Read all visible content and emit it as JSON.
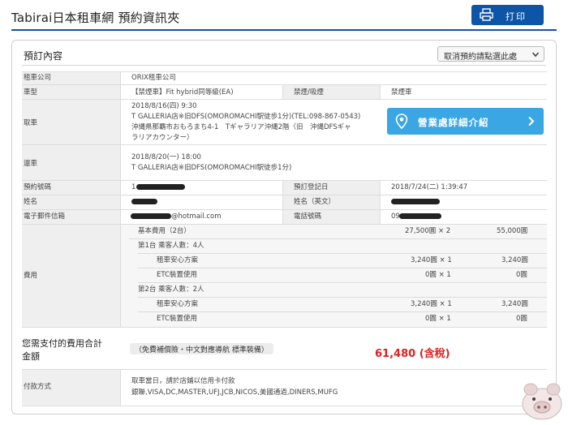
{
  "header": {
    "title": "Tabirai日本租車網 預約資訊夾",
    "print_label": "打印"
  },
  "card": {
    "title": "預訂內容",
    "cancel_select": "取消預約請點選此處"
  },
  "rows": {
    "company": {
      "label": "租車公司",
      "value": "ORIX租車公司"
    },
    "car_type": {
      "label": "車型",
      "value": "【禁煙車】Fit  hybrid同等級(EA)",
      "smoke_label": "禁煙/吸煙",
      "smoke_value": "禁煙車"
    },
    "pickup": {
      "label": "取車",
      "line1": "2018/8/16(四) 9:30",
      "line2": "T GALLERIA店※旧DFS(OMOROMACHI駅徒歩1分)(TEL:098-867-0543)",
      "line3": "沖縄県那覇市おもろまち4-1　Tギャラリア沖縄2階（旧　沖縄DFSギャ",
      "line4": "ラリアカウンター）",
      "guide_button": "營業處詳細介紹"
    },
    "return": {
      "label": "還車",
      "line1": "2018/8/20(一) 18:00",
      "line2": "T GALLERIA店※旧DFS(OMOROMACHI駅徒歩1分)"
    },
    "booking_no": {
      "label": "預約號碼",
      "value": "1",
      "reg_label": "預訂登記日",
      "reg_value": "2018/7/24(二) 1:39:47"
    },
    "name": {
      "label": "姓名",
      "en_label": "姓名（英文）"
    },
    "email": {
      "label": "電子郵件信箱",
      "value": "@hotmail.com",
      "phone_label": "電話號碼",
      "phone_value": "09"
    },
    "fees": {
      "label": "費用",
      "basic": {
        "label": "基本費用（2台）",
        "unit": "27,500圓 × 2",
        "total": "55,000圓"
      },
      "car1": {
        "label": "第1台 乘客人數：4人"
      },
      "car1_items": [
        {
          "label": "租車安心方案",
          "unit": "3,240圓 × 1",
          "total": "3,240圓"
        },
        {
          "label": "ETC裝置使用",
          "unit": "0圓 × 1",
          "total": "0圓"
        }
      ],
      "car2": {
        "label": "第2台 乘客人數：2人"
      },
      "car2_items": [
        {
          "label": "租車安心方案",
          "unit": "3,240圓 × 1",
          "total": "3,240圓"
        },
        {
          "label": "ETC裝置使用",
          "unit": "0圓 × 1",
          "total": "0圓"
        }
      ]
    },
    "total": {
      "label": "您需支付的費用合計金額",
      "tag": "（免費補償險・中文對應導航 標準裝備）",
      "value": "61,480 (含稅)"
    },
    "payment": {
      "label": "付款方式",
      "line1": "取車當日，請於店鋪以信用卡付款",
      "line2": "銀聯,VISA,DC,MASTER,UFJ,JCB,NICOS,美國通過,DINERS,MUFG"
    }
  },
  "colors": {
    "accent": "#0d55a6",
    "button": "#3aa6e3",
    "total": "#e02020",
    "label_bg": "#efefef"
  },
  "icons": [
    "printer-icon",
    "chevron-down-icon",
    "map-pin-icon",
    "chevron-right-icon",
    "pig-watermark"
  ]
}
